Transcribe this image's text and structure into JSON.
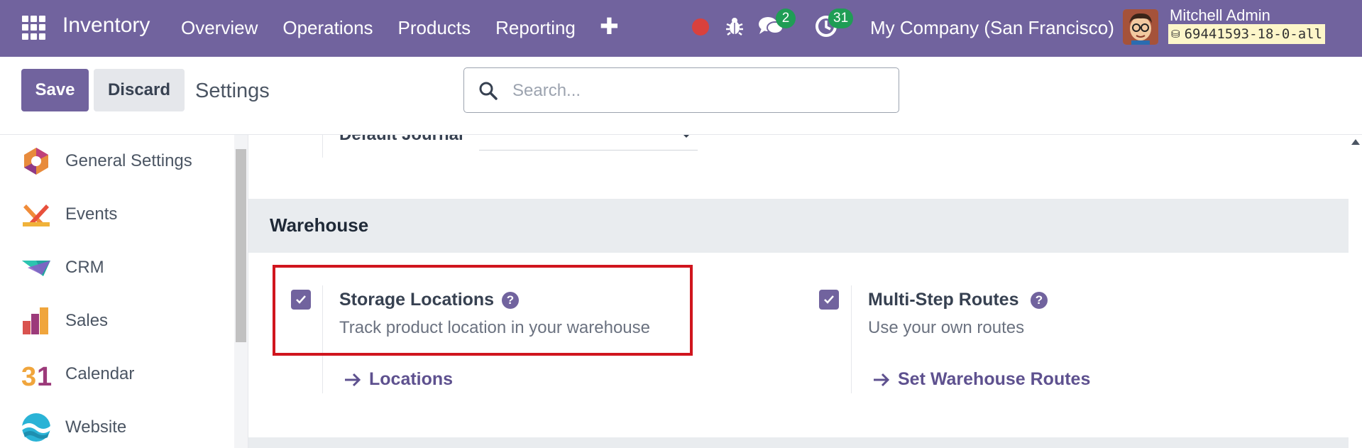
{
  "navbar": {
    "brand": "Inventory",
    "menu": [
      "Overview",
      "Operations",
      "Products",
      "Reporting"
    ],
    "chat_count": "2",
    "activity_count": "31",
    "company": "My Company (San Francisco)",
    "user_name": "Mitchell Admin",
    "db_name": "69441593-18-0-all",
    "color": "#71639e"
  },
  "control": {
    "save_label": "Save",
    "discard_label": "Discard",
    "breadcrumb": "Settings",
    "search_placeholder": "Search..."
  },
  "sidebar": {
    "items": [
      {
        "label": "General Settings",
        "icon": "general-settings-icon"
      },
      {
        "label": "Events",
        "icon": "events-icon"
      },
      {
        "label": "CRM",
        "icon": "crm-icon"
      },
      {
        "label": "Sales",
        "icon": "sales-icon"
      },
      {
        "label": "Calendar",
        "icon": "calendar-icon"
      },
      {
        "label": "Website",
        "icon": "website-icon"
      }
    ]
  },
  "main": {
    "partial_field_label": "Default Journal",
    "section_title": "Warehouse",
    "settings": [
      {
        "title": "Storage Locations",
        "description": "Track product location in your warehouse",
        "checked": true,
        "link": "Locations"
      },
      {
        "title": "Multi-Step Routes",
        "description": "Use your own routes",
        "checked": true,
        "link": "Set Warehouse Routes"
      }
    ]
  }
}
